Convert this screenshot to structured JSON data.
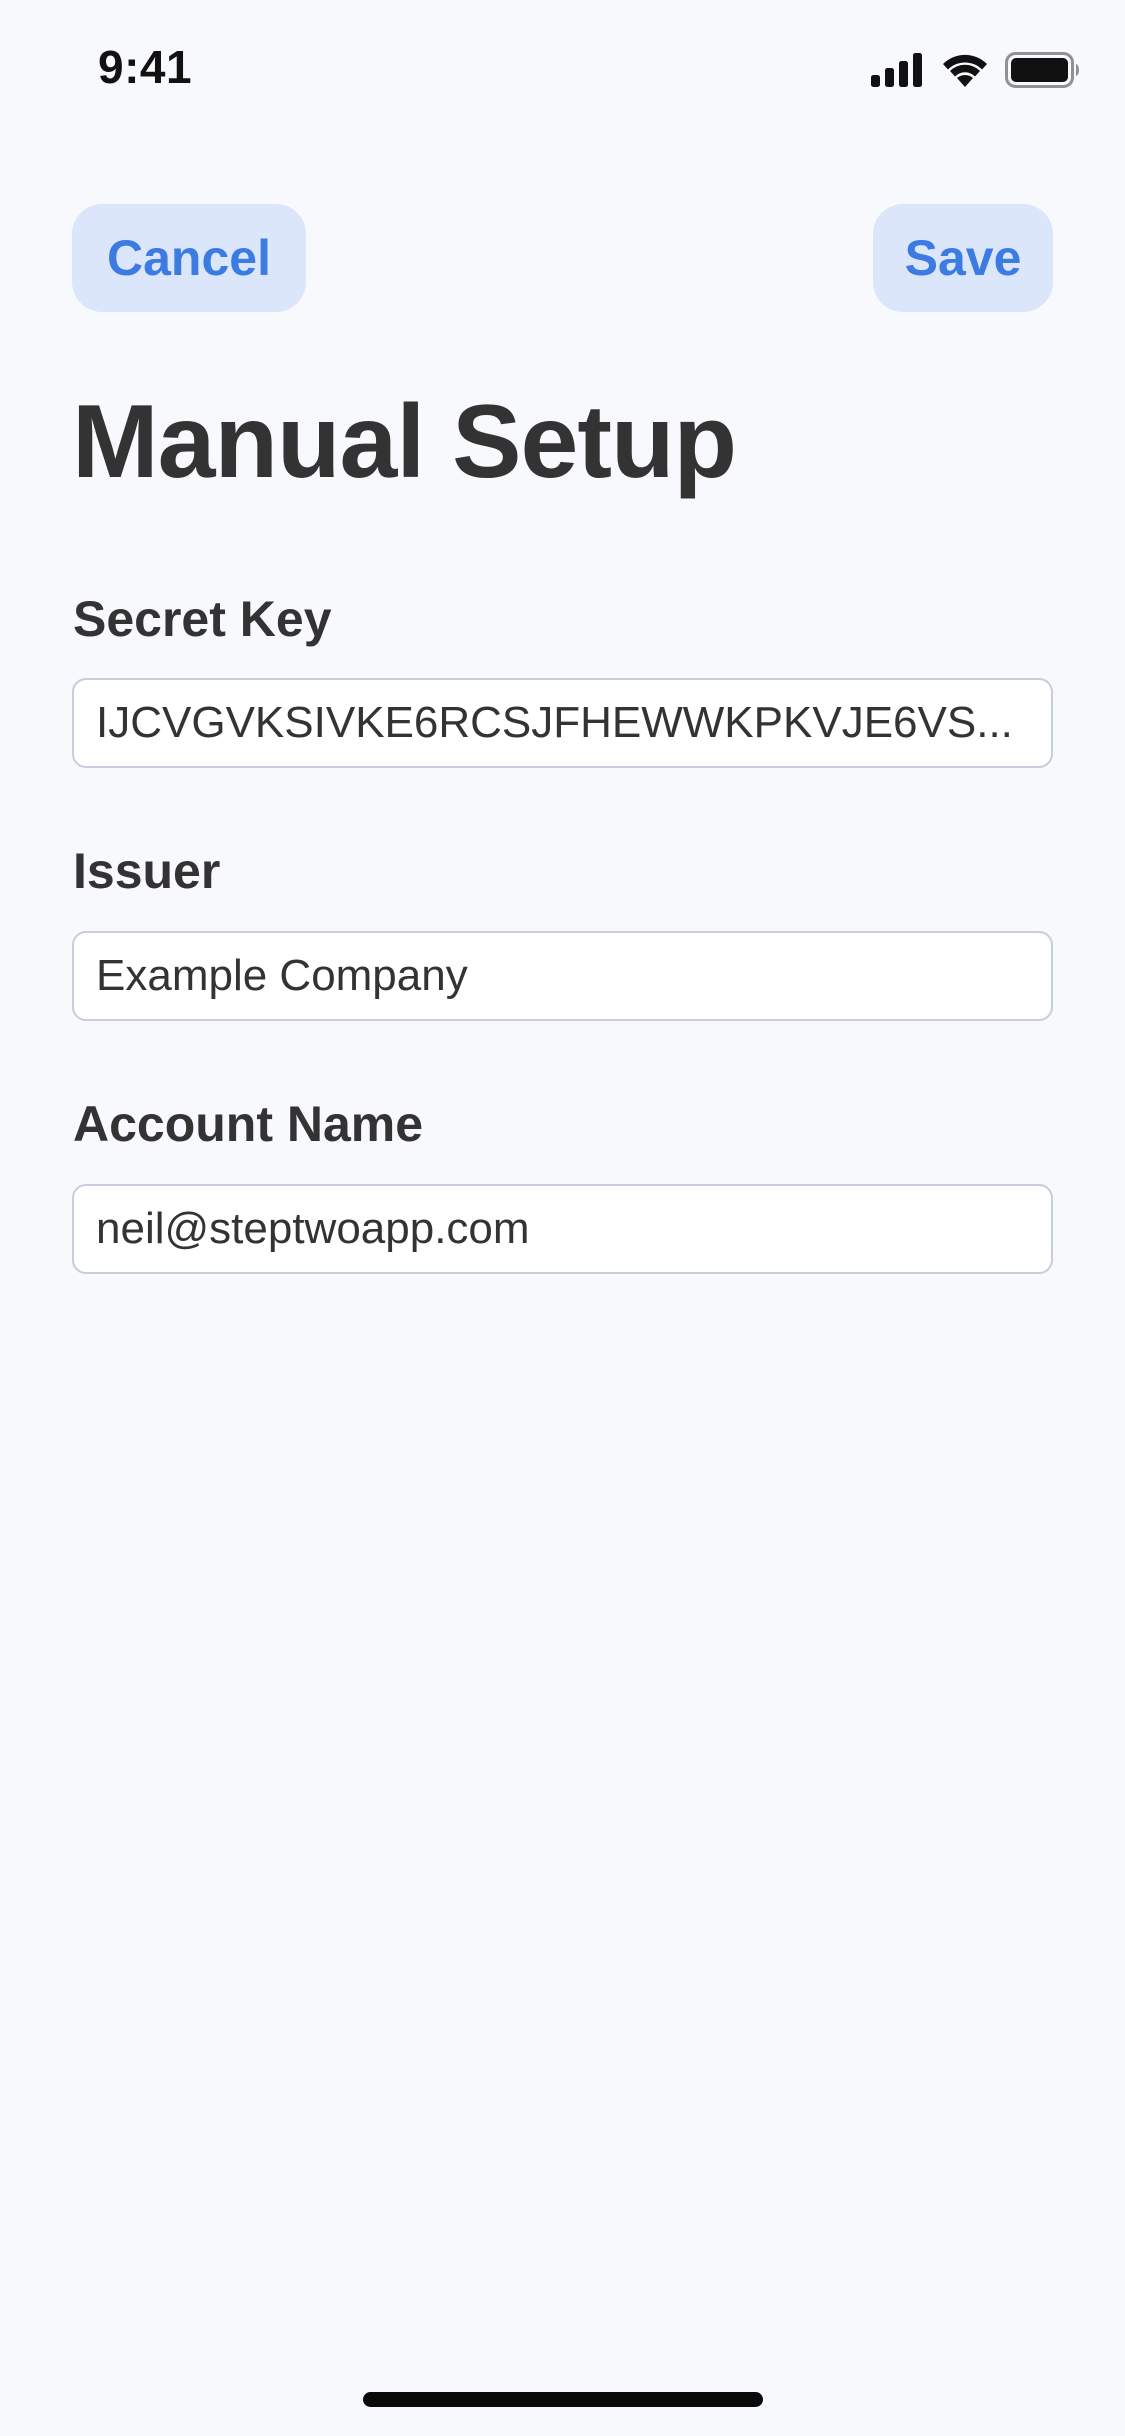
{
  "status_bar": {
    "time": "9:41",
    "icons": [
      "cellular-signal-icon",
      "wifi-icon",
      "battery-icon"
    ]
  },
  "nav": {
    "cancel_label": "Cancel",
    "save_label": "Save"
  },
  "title": "Manual Setup",
  "fields": {
    "secret_key": {
      "label": "Secret Key",
      "value": "IJCVGVKSIVKE6RCSJFHEWWKPKVJE6VS..."
    },
    "issuer": {
      "label": "Issuer",
      "value": "Example Company"
    },
    "account_name": {
      "label": "Account Name",
      "value": "neil@steptwoapp.com"
    }
  },
  "colors": {
    "accent": "#3B7BE2",
    "button_bg": "#DCE6FA",
    "background": "#F8F9FC",
    "text": "#333333"
  }
}
